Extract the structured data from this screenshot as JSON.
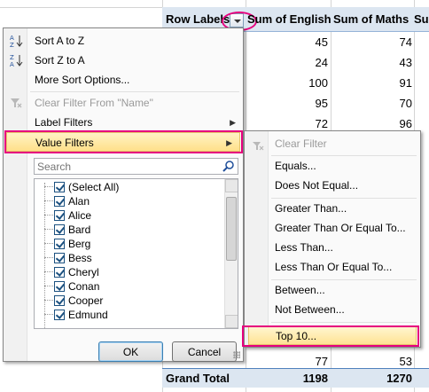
{
  "pivot": {
    "headers": {
      "row_labels": "Row Labels",
      "sum_english": "Sum of English",
      "sum_maths": "Sum of Maths",
      "cut_off": "Su"
    },
    "rows": [
      {
        "english": "45",
        "maths": "74"
      },
      {
        "english": "24",
        "maths": "43"
      },
      {
        "english": "100",
        "maths": "91"
      },
      {
        "english": "95",
        "maths": "70"
      },
      {
        "english": "72",
        "maths": "96"
      }
    ],
    "bottom_rows": [
      {
        "english": "77",
        "maths": "53"
      }
    ],
    "grand_total": {
      "label": "Grand Total",
      "english": "1198",
      "maths": "1270"
    }
  },
  "filter_menu": {
    "sort_a_to_z": "Sort A to Z",
    "sort_z_to_a": "Sort Z to A",
    "more_sort_options": "More Sort Options...",
    "clear_filter": "Clear Filter From \"Name\"",
    "label_filters": "Label Filters",
    "value_filters": "Value Filters",
    "search_placeholder": "Search",
    "items": [
      {
        "label": "(Select All)",
        "checked": true
      },
      {
        "label": "Alan",
        "checked": true
      },
      {
        "label": "Alice",
        "checked": true
      },
      {
        "label": "Bard",
        "checked": true
      },
      {
        "label": "Berg",
        "checked": true
      },
      {
        "label": "Bess",
        "checked": true
      },
      {
        "label": "Cheryl",
        "checked": true
      },
      {
        "label": "Conan",
        "checked": true
      },
      {
        "label": "Cooper",
        "checked": true
      },
      {
        "label": "Edmund",
        "checked": true
      }
    ],
    "ok": "OK",
    "cancel": "Cancel"
  },
  "value_filters_submenu": {
    "clear_filter": "Clear Filter",
    "equals": "Equals...",
    "does_not_equal": "Does Not Equal...",
    "greater_than": "Greater Than...",
    "greater_than_or_equal": "Greater Than Or Equal To...",
    "less_than": "Less Than...",
    "less_than_or_equal": "Less Than Or Equal To...",
    "between": "Between...",
    "not_between": "Not Between...",
    "top_10": "Top 10..."
  },
  "colors": {
    "highlight_pink": "#e6007e",
    "hover_yellow": "#ffe08a",
    "pivot_header_blue": "#dce6f1"
  }
}
